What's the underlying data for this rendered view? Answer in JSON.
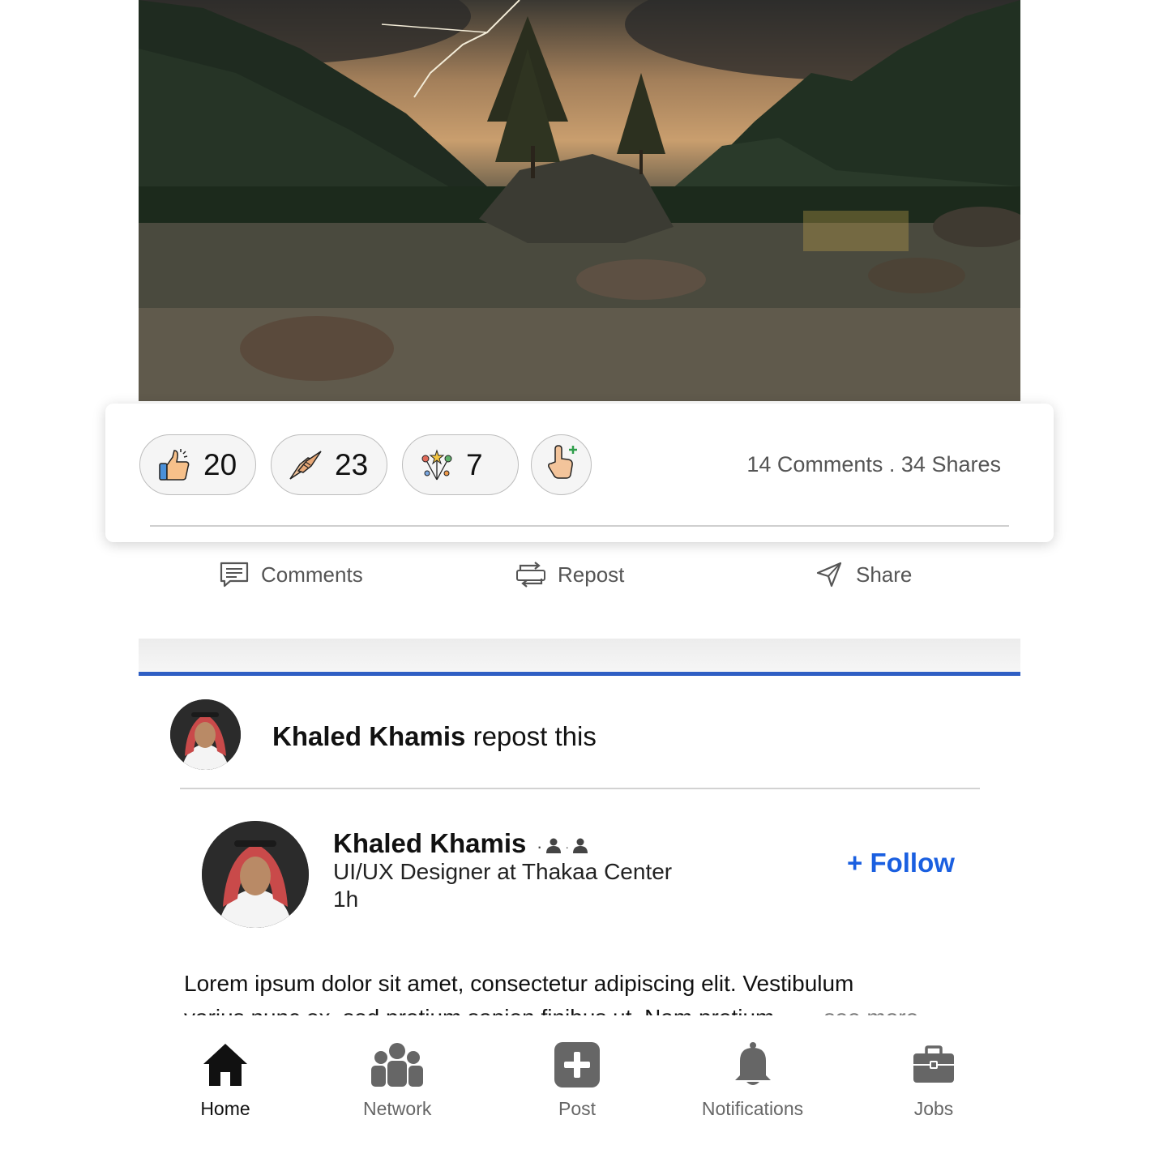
{
  "post_image": {
    "alt_icon": "landscape-photo"
  },
  "reactions": [
    {
      "icon": "thumbs-up-icon",
      "count": "20"
    },
    {
      "icon": "handshake-icon",
      "count": "23"
    },
    {
      "icon": "celebrate-icon",
      "count": "7"
    }
  ],
  "add_reaction_icon": "add-reaction-icon",
  "stats": "14 Comments . 34 Shares",
  "actions": {
    "comments": "Comments",
    "repost": "Repost",
    "share": "Share"
  },
  "repost": {
    "user": "Khaled Khamis",
    "suffix": " repost this"
  },
  "author": {
    "name": "Khaled Khamis",
    "separator": "·",
    "title": "UI/UX Designer at Thakaa Center",
    "time": "1h",
    "follow_label": "+ Follow"
  },
  "post": {
    "line1": "Lorem ipsum dolor sit amet, consectetur adipiscing elit. Vestibulum",
    "line2": "varius nunc ex, sed pretium sapien finibus ut. Nam pretium",
    "see_more": "...see more"
  },
  "nav": [
    {
      "label": "Home",
      "icon": "home-icon",
      "active": true
    },
    {
      "label": "Network",
      "icon": "network-icon",
      "active": false
    },
    {
      "label": "Post",
      "icon": "post-icon",
      "active": false
    },
    {
      "label": "Notifications",
      "icon": "bell-icon",
      "active": false
    },
    {
      "label": "Jobs",
      "icon": "briefcase-icon",
      "active": false
    }
  ],
  "colors": {
    "accent": "#1a5fe0",
    "band_line": "#2f5fc4",
    "muted": "#555555"
  }
}
